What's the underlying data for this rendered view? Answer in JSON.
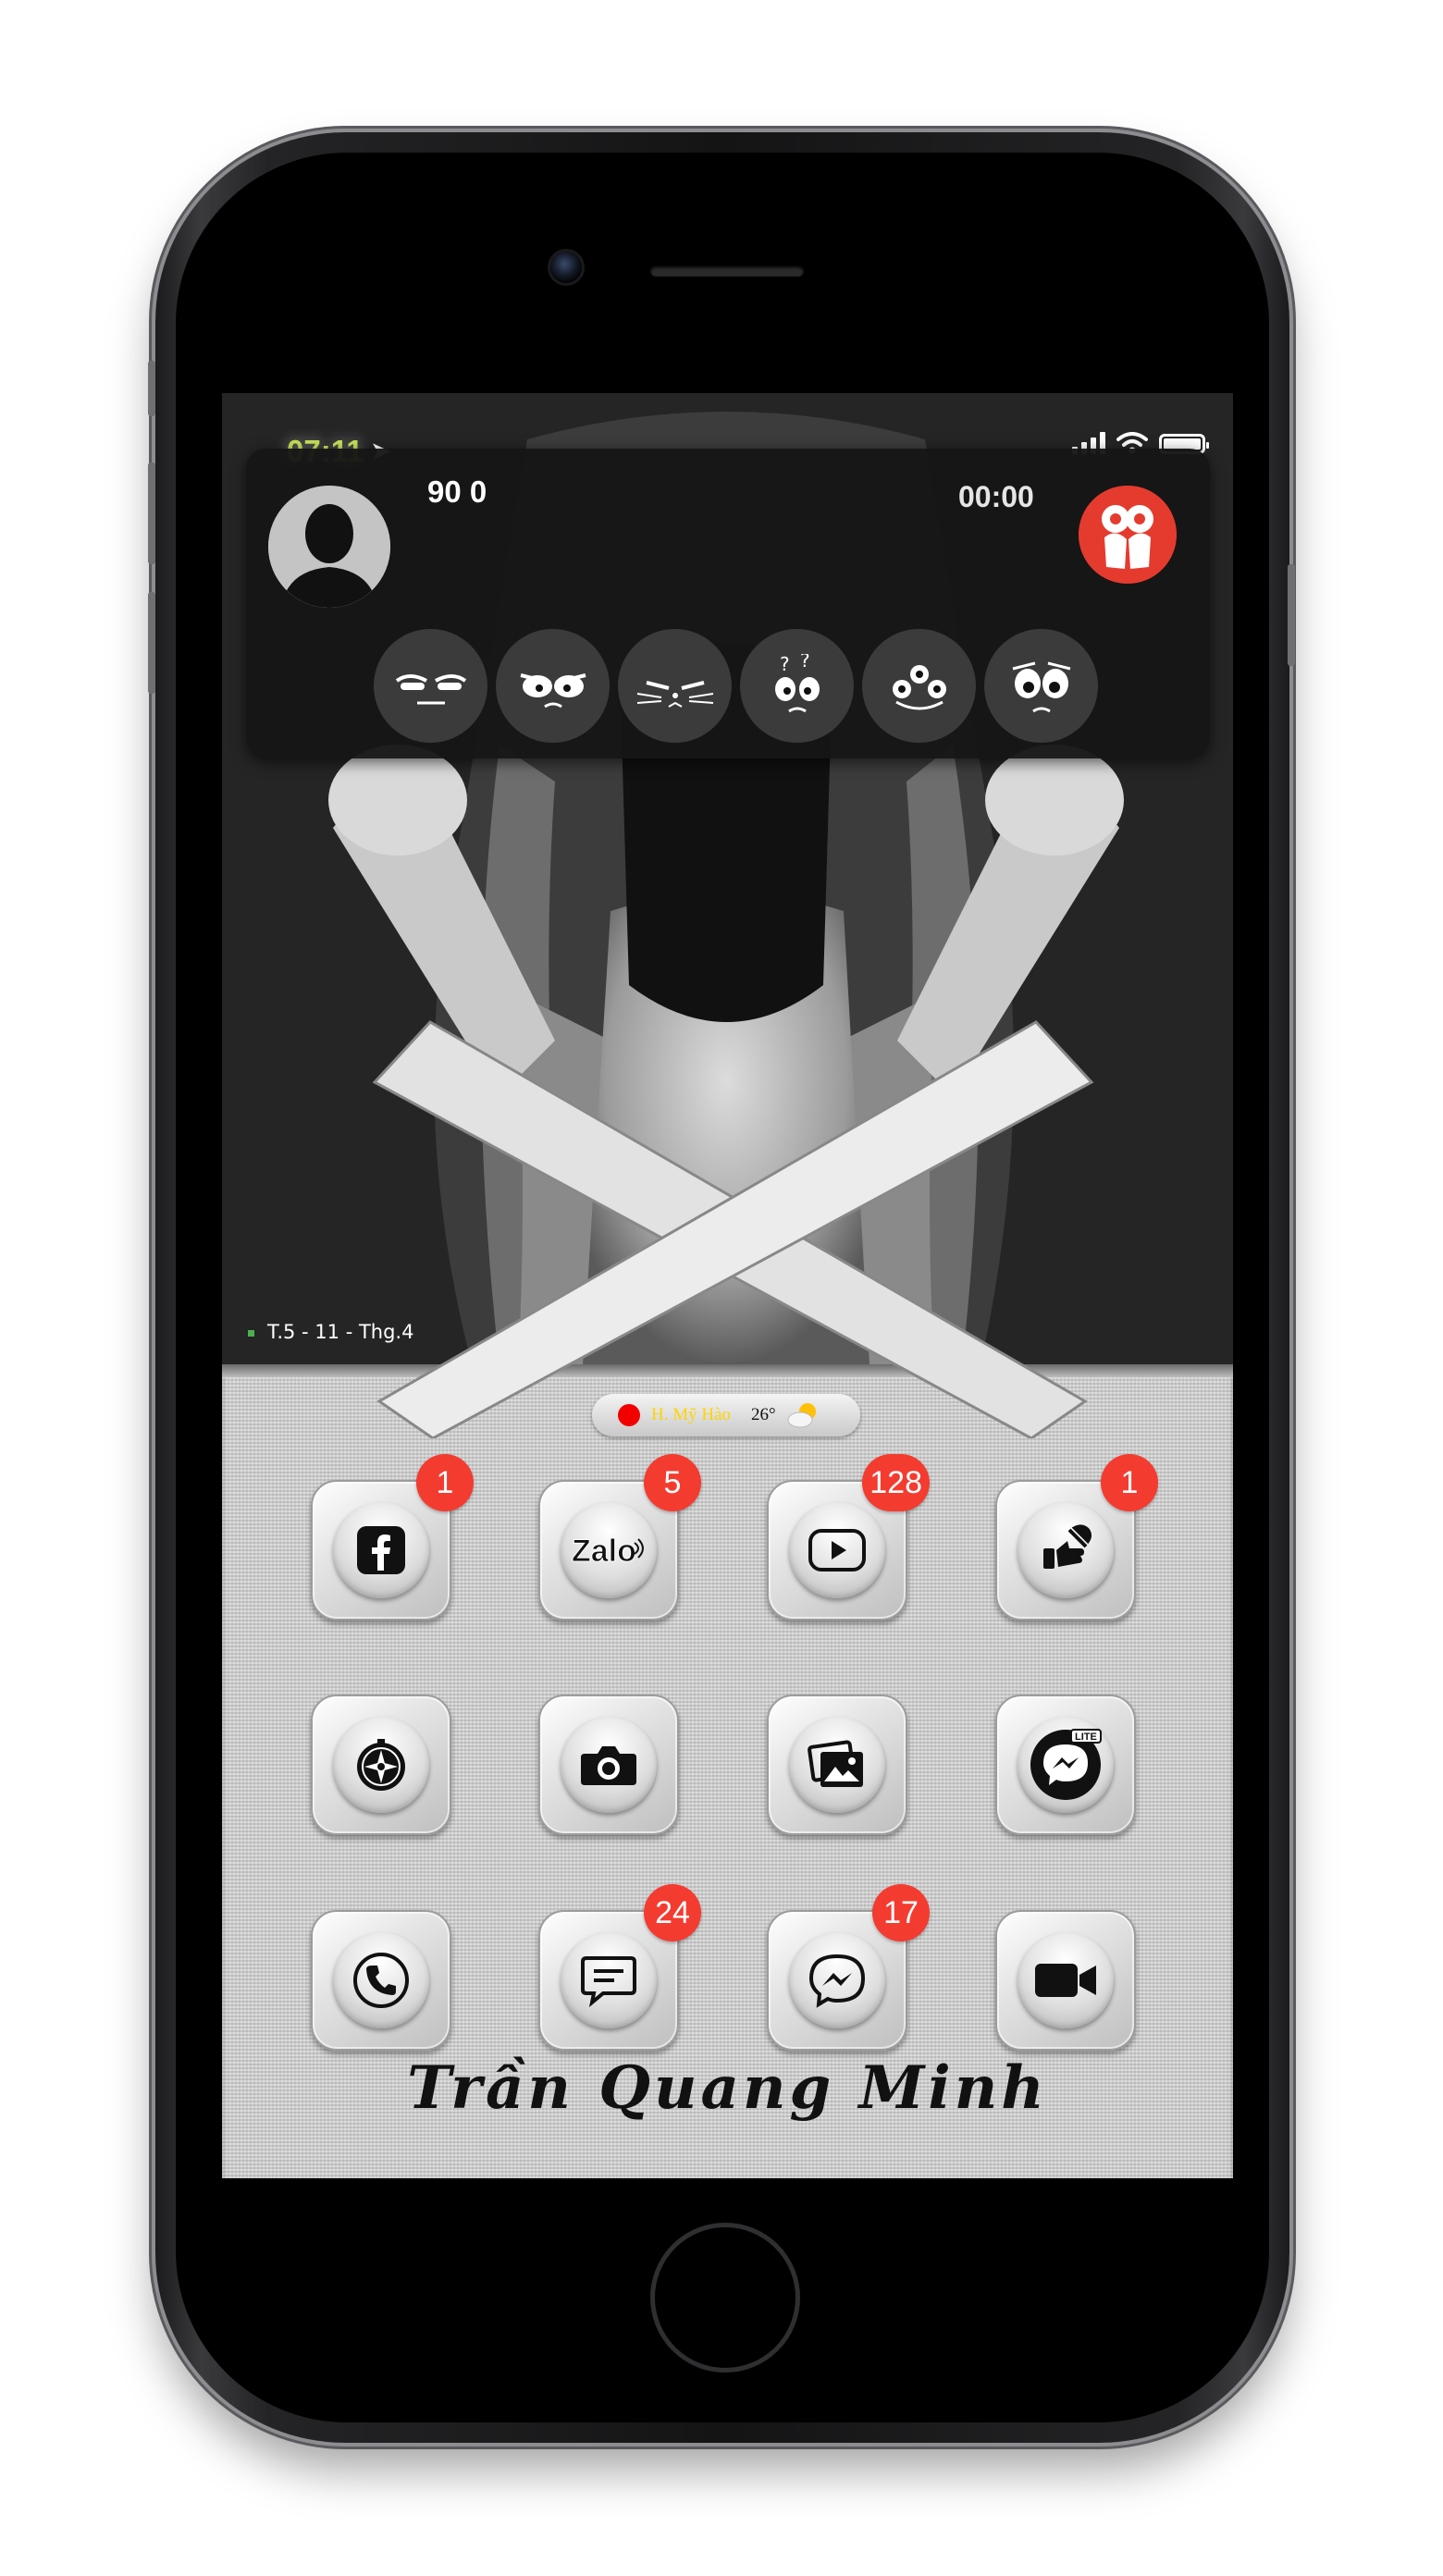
{
  "status_bar": {
    "time": "07:11"
  },
  "call": {
    "caller_name": "90 0",
    "timer": "00:00"
  },
  "reactions": [
    {
      "name": "sleepy-face-icon"
    },
    {
      "name": "angry-face-icon"
    },
    {
      "name": "cat-face-icon"
    },
    {
      "name": "confused-face-icon"
    },
    {
      "name": "monster-face-icon"
    },
    {
      "name": "sad-face-icon"
    }
  ],
  "lock_date": "T.5 - 11 - Thg.4",
  "weather": {
    "location": "H. Mỹ Hào",
    "temperature": "26°"
  },
  "apps": [
    {
      "icon": "facebook-icon",
      "badge": "1"
    },
    {
      "icon": "zalo-icon",
      "badge": "5"
    },
    {
      "icon": "youtube-icon",
      "badge": "128"
    },
    {
      "icon": "settings-tool-icon",
      "badge": "1"
    },
    {
      "icon": "compass-icon",
      "badge": ""
    },
    {
      "icon": "camera-icon",
      "badge": ""
    },
    {
      "icon": "photos-icon",
      "badge": ""
    },
    {
      "icon": "messenger-lite-icon",
      "badge": ""
    },
    {
      "icon": "phone-icon",
      "badge": ""
    },
    {
      "icon": "messages-icon",
      "badge": "24"
    },
    {
      "icon": "messenger-icon",
      "badge": "17"
    },
    {
      "icon": "video-call-icon",
      "badge": ""
    }
  ],
  "signature": "Trần Quang Minh",
  "colors": {
    "badge": "#f43b30",
    "end_call": "#e53b2e",
    "clock": "#c8e45a"
  }
}
